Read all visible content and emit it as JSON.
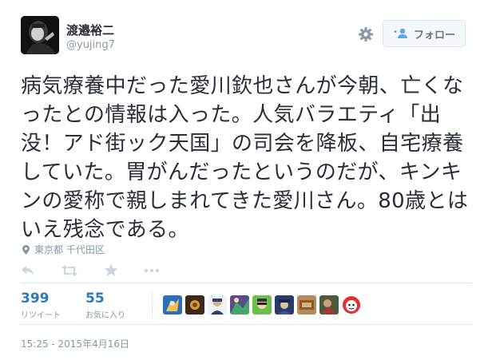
{
  "user": {
    "name": "渡邉裕二",
    "handle": "@yujing7"
  },
  "follow_button": {
    "label": "フォロー",
    "icon": "add-user-icon"
  },
  "tweet": {
    "text": "病気療養中だった愛川欽也さんが今朝、亡くなったとの情報は入った。人気バラエティ「出没！アド街ック天国」の司会を降板、自宅療養していた。胃がんだったというのだが、キンキンの愛称で親しまれてきた愛川さん。80歳とはいえ残念である。"
  },
  "location": {
    "icon": "map-pin-icon",
    "text": "東京都 千代田区"
  },
  "actions": [
    "reply-icon",
    "retweet-icon",
    "favorite-star-icon",
    "more-dots-icon"
  ],
  "stats": {
    "retweets": {
      "count": "399",
      "label": "リツイート"
    },
    "favorites": {
      "count": "55",
      "label": "お気に入り"
    }
  },
  "likers_count": 9,
  "timestamp": "15:25 - 2015年4月16日",
  "colors": {
    "text": "#292f33",
    "muted": "#8899a6",
    "link_blue": "#2b7bb9",
    "border": "#e1e8ed",
    "button_bg": "#f5f8fa"
  }
}
